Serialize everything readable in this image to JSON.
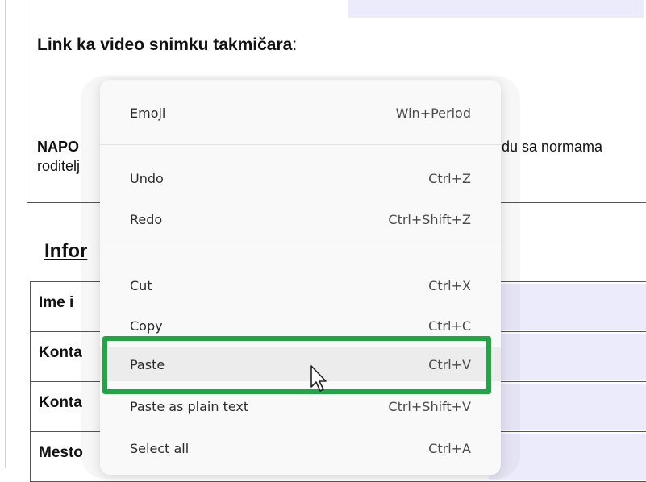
{
  "document": {
    "link_label": "Link ka video snimku takmičara",
    "link_colon": ":",
    "napomena_partial": "NAPO",
    "napomena_rest": "du sa normama",
    "roditelj_partial": "roditelj",
    "info_heading_partial": "Infor",
    "table_rows": [
      {
        "label": "Ime i"
      },
      {
        "label": "Konta"
      },
      {
        "label": "Konta"
      },
      {
        "label": "Mesto"
      }
    ]
  },
  "context_menu": {
    "items": [
      {
        "label": "Emoji",
        "shortcut": "Win+Period"
      },
      {
        "label": "Undo",
        "shortcut": "Ctrl+Z"
      },
      {
        "label": "Redo",
        "shortcut": "Ctrl+Shift+Z"
      },
      {
        "label": "Cut",
        "shortcut": "Ctrl+X"
      },
      {
        "label": "Copy",
        "shortcut": "Ctrl+C"
      },
      {
        "label": "Paste",
        "shortcut": "Ctrl+V"
      },
      {
        "label": "Paste as plain text",
        "shortcut": "Ctrl+Shift+V"
      },
      {
        "label": "Select all",
        "shortcut": "Ctrl+A"
      }
    ],
    "hovered_item": "Paste"
  },
  "colors": {
    "highlight_border": "#22a645",
    "field_fill": "#ebebfb"
  },
  "icons": {
    "cursor": "mouse-pointer-icon"
  }
}
